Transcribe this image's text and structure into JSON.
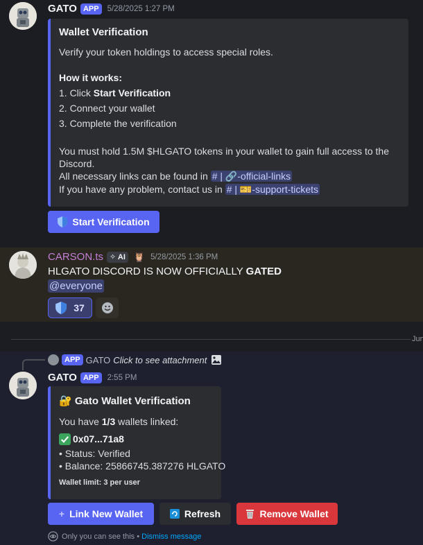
{
  "msg1": {
    "username": "GATO",
    "badge": "APP",
    "timestamp": "5/28/2025 1:27 PM",
    "embed": {
      "title": "Wallet Verification",
      "description": "Verify your token holdings to access special roles.",
      "how_title": "How it works:",
      "step1_prefix": "1. Click ",
      "step1_bold": "Start Verification",
      "step2": "2. Connect your wallet",
      "step3": "3. Complete the verification",
      "hold_line1": "You must hold 1.5M $HLGATO tokens in your wallet to gain full access to the",
      "hold_line2": "Discord.",
      "links_prefix": "All necessary links can be found in",
      "links_channel": "-official-links",
      "support_prefix": "If you have any problem, contact us in",
      "support_channel": "-support-tickets",
      "channel_hash": "#",
      "channel_sep": "|"
    },
    "button": {
      "label": "Start Verification",
      "icon": "shield-icon"
    }
  },
  "msg2": {
    "username": "CARSON.ts",
    "ai_badge": "AI",
    "timestamp": "5/28/2025 1:36 PM",
    "text_prefix": "HLGATO DISCORD IS NOW OFFICIALLY ",
    "text_bold": "GATED",
    "mention": "@everyone",
    "reaction_count": "37",
    "colors": {
      "username": "#c27fd6",
      "highlight_bg": "#2a2720"
    }
  },
  "divider": {
    "date_label": "Jun"
  },
  "msg3": {
    "reply": {
      "badge": "APP",
      "username": "GATO",
      "text": "Click to see attachment"
    },
    "username": "GATO",
    "badge": "APP",
    "timestamp": "2:55 PM",
    "embed": {
      "title": "Gato Wallet Verification",
      "linked_prefix": "You have ",
      "linked_bold": "1/3",
      "linked_suffix": " wallets linked:",
      "wallet": "0x07...71a8",
      "status": "• Status: Verified",
      "balance": "• Balance: 25866745.387276 HLGATO",
      "limit": "Wallet limit: 3 per user"
    },
    "buttons": {
      "link_new": "Link New Wallet",
      "refresh": "Refresh",
      "remove": "Remove Wallet"
    },
    "ephemeral": {
      "text": "Only you can see this • ",
      "dismiss": "Dismiss message"
    }
  },
  "colors": {
    "accent": "#5865f2",
    "danger": "#da373c",
    "link": "#00a8fc"
  }
}
